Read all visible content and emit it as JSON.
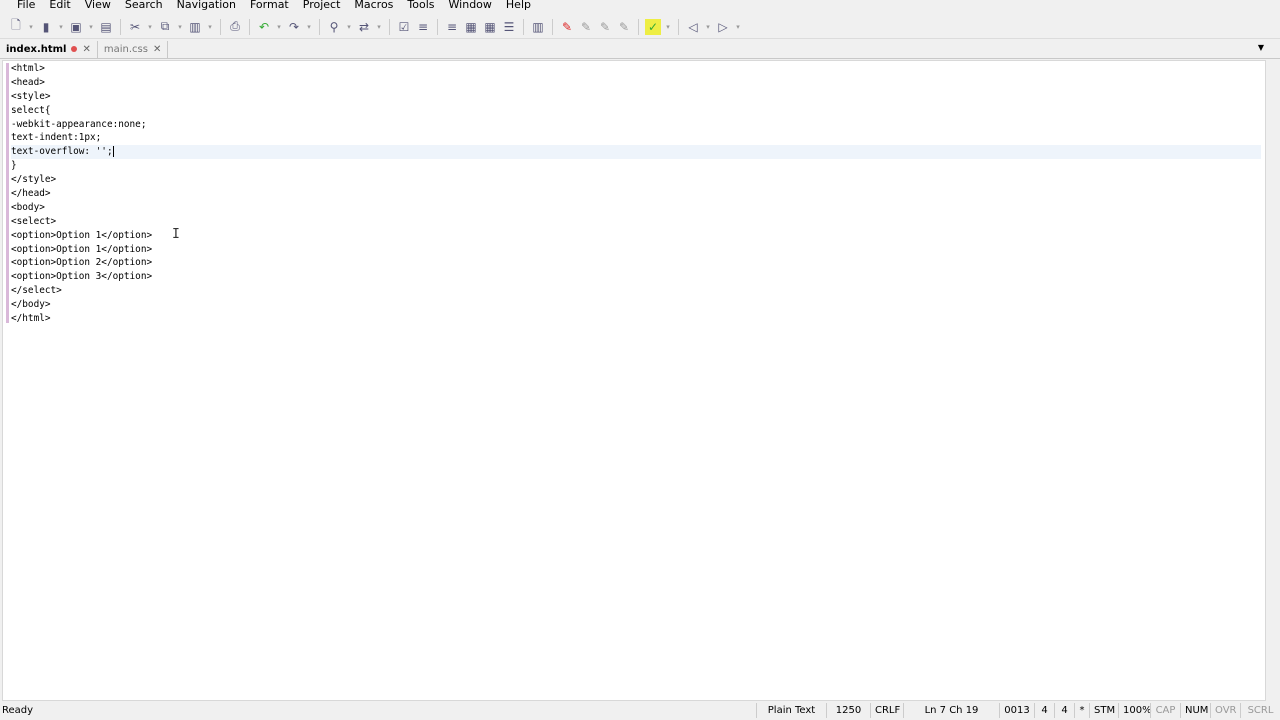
{
  "menu": [
    "File",
    "Edit",
    "View",
    "Search",
    "Navigation",
    "Format",
    "Project",
    "Macros",
    "Tools",
    "Window",
    "Help"
  ],
  "toolbar": [
    "new-file-icon",
    "open-file-icon",
    "save-icon",
    "save-all-icon",
    "cut-icon",
    "copy-icon",
    "paste-icon",
    "print-icon",
    "undo-icon",
    "redo-icon",
    "find-icon",
    "replace-icon",
    "word-wrap-icon",
    "indent-icon",
    "unindent-icon",
    "block-indent-icon",
    "block-unindent-icon",
    "format-icon",
    "columns-icon",
    "marker-icon",
    "highlight-icon",
    "highlight2-icon",
    "highlight3-icon",
    "spellcheck-icon",
    "back-icon",
    "forward-icon"
  ],
  "tabs": [
    {
      "label": "index.html",
      "modified": true
    },
    {
      "label": "main.css",
      "modified": false
    }
  ],
  "code": [
    "<html>",
    "<head>",
    "<style>",
    "select{",
    "-webkit-appearance:none;",
    "text-indent:1px;",
    "text-overflow: '';",
    "}",
    "</style>",
    "</head>",
    "<body>",
    "<select>",
    "<option>Option 1</option>",
    "<option>Option 1</option>",
    "<option>Option 2</option>",
    "<option>Option 3</option>",
    "</select>",
    "</body>",
    "</html>"
  ],
  "status": {
    "ready": "Ready",
    "syntax": "Plain Text",
    "codepage": "1250",
    "eol": "CRLF",
    "position": "Ln  7 Ch 19",
    "char": "0013",
    "tab": "4",
    "indent": "4",
    "modified": "*",
    "stm": "STM",
    "zoom": "100%",
    "cap": "CAP",
    "num": "NUM",
    "ovr": "OVR",
    "scrl": "SCRL"
  }
}
